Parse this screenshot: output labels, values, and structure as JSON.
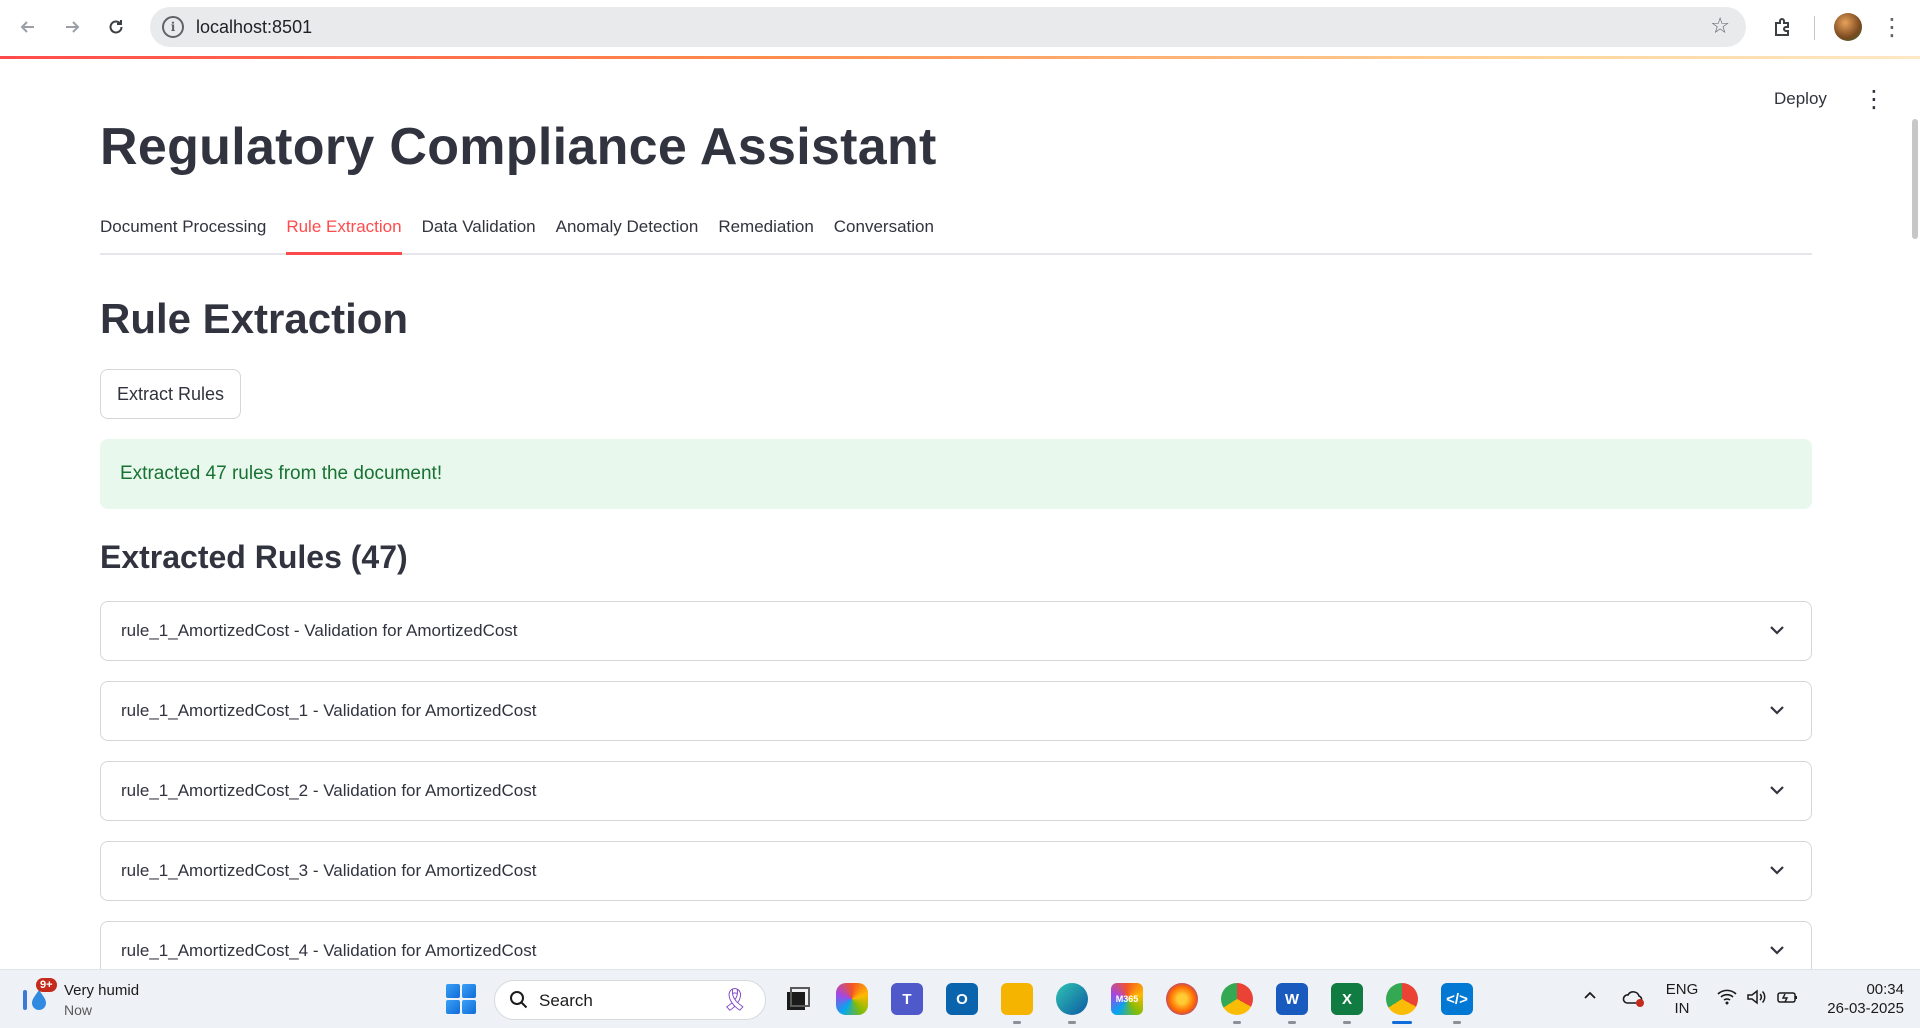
{
  "browser": {
    "url": "localhost:8501"
  },
  "app": {
    "deploy_label": "Deploy",
    "title": "Regulatory Compliance Assistant",
    "tabs": [
      {
        "label": "Document Processing",
        "active": false
      },
      {
        "label": "Rule Extraction",
        "active": true
      },
      {
        "label": "Data Validation",
        "active": false
      },
      {
        "label": "Anomaly Detection",
        "active": false
      },
      {
        "label": "Remediation",
        "active": false
      },
      {
        "label": "Conversation",
        "active": false
      }
    ],
    "section_title": "Rule Extraction",
    "extract_button": "Extract Rules",
    "success_message": "Extracted 47 rules from the document!",
    "rules_heading": "Extracted Rules (47)",
    "rules": [
      "rule_1_AmortizedCost - Validation for AmortizedCost",
      "rule_1_AmortizedCost_1 - Validation for AmortizedCost",
      "rule_1_AmortizedCost_2 - Validation for AmortizedCost",
      "rule_1_AmortizedCost_3 - Validation for AmortizedCost",
      "rule_1_AmortizedCost_4 - Validation for AmortizedCost"
    ],
    "colors": {
      "accent": "#ff4b4b",
      "success_bg": "#e8f8ec",
      "success_text": "#177233",
      "text": "#31333f"
    }
  },
  "taskbar": {
    "weather_title": "Very humid",
    "weather_sub": "Now",
    "weather_badge": "9+",
    "search_label": "Search",
    "lang_top": "ENG",
    "lang_bottom": "IN",
    "time": "00:34",
    "date": "26-03-2025"
  }
}
